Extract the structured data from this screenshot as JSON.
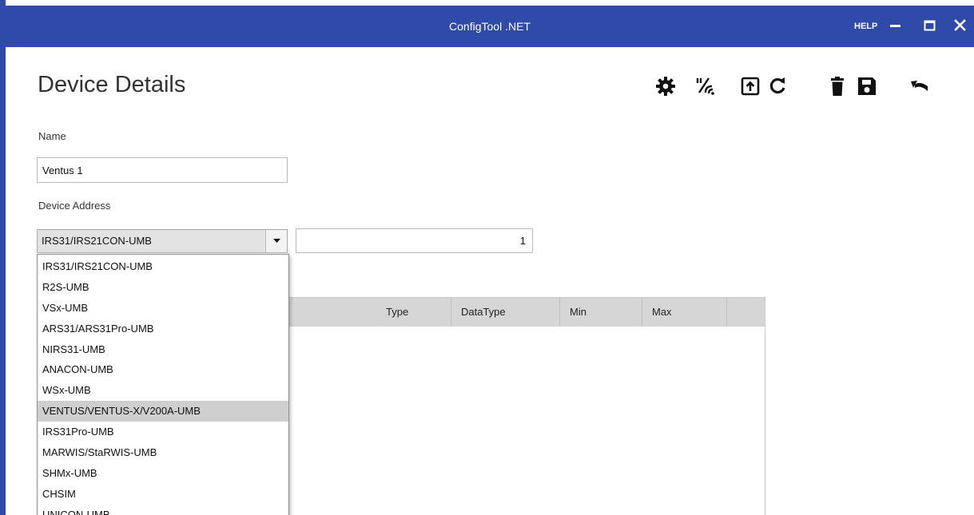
{
  "window": {
    "title": "ConfigTool .NET",
    "help_label": "HELP"
  },
  "header": {
    "title": "Device Details",
    "toolbar_icons": [
      "gear-icon",
      "wireless-sensor-icon",
      "upload-icon",
      "refresh-icon",
      "delete-icon",
      "save-icon",
      "undo-icon"
    ]
  },
  "form": {
    "name_label": "Name",
    "name_value": "Ventus 1",
    "address_label": "Device Address",
    "address_selected": "IRS31/IRS21CON-UMB",
    "address_number": "1"
  },
  "dropdown": {
    "options": [
      "IRS31/IRS21CON-UMB",
      "R2S-UMB",
      "VSx-UMB",
      "ARS31/ARS31Pro-UMB",
      "NIRS31-UMB",
      "ANACON-UMB",
      "WSx-UMB",
      "VENTUS/VENTUS-X/V200A-UMB",
      "IRS31Pro-UMB",
      "MARWIS/StaRWIS-UMB",
      "SHMx-UMB",
      "CHSIM",
      "UNICON-UMB"
    ],
    "highlighted": "VENTUS/VENTUS-X/V200A-UMB"
  },
  "grid": {
    "columns": [
      "Type",
      "DataType",
      "Min",
      "Max"
    ]
  },
  "colors": {
    "titlebar": "#2f4aa8",
    "header_row": "#d6d6d6",
    "highlight": "#cfcfcf"
  }
}
